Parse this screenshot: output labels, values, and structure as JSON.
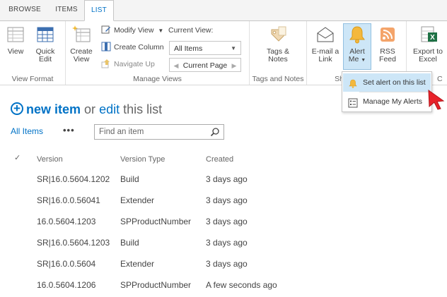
{
  "tabs": {
    "browse": "BROWSE",
    "items": "ITEMS",
    "list": "LIST"
  },
  "ribbon": {
    "view_format": {
      "label": "View Format",
      "view": "View",
      "quick_edit_1": "Quick",
      "quick_edit_2": "Edit"
    },
    "manage_views": {
      "label": "Manage Views",
      "create_view_1": "Create",
      "create_view_2": "View",
      "modify_view": "Modify View",
      "create_column": "Create Column",
      "navigate_up": "Navigate Up",
      "current_view_label": "Current View:",
      "current_view_value": "All Items",
      "current_page": "Current Page"
    },
    "tags_notes": {
      "label": "Tags and Notes",
      "btn_1": "Tags &",
      "btn_2": "Notes"
    },
    "share": {
      "label_partial": "Sh",
      "email_1": "E-mail a",
      "email_2": "Link",
      "alert_1": "Alert",
      "alert_2": "Me",
      "rss_1": "RSS",
      "rss_2": "Feed"
    },
    "connect": {
      "label_partial": "C",
      "export_1": "Export to",
      "export_2": "Excel"
    }
  },
  "alert_menu": {
    "set_alert": "Set alert on this list",
    "manage_alerts": "Manage My Alerts"
  },
  "title": {
    "new_item": "new item",
    "or": "or",
    "edit": "edit",
    "this_list": "this list"
  },
  "view": {
    "all_items": "All Items",
    "more": "•••",
    "search_placeholder": "Find an item"
  },
  "table": {
    "columns": [
      "Version",
      "Version Type",
      "Created"
    ],
    "rows": [
      [
        "SR|16.0.5604.1202",
        "Build",
        "3 days ago"
      ],
      [
        "SR|16.0.0.56041",
        "Extender",
        "3 days ago"
      ],
      [
        "16.0.5604.1203",
        "SPProductNumber",
        "3 days ago"
      ],
      [
        "SR|16.0.5604.1203",
        "Build",
        "3 days ago"
      ],
      [
        "SR|16.0.0.5604",
        "Extender",
        "3 days ago"
      ],
      [
        "16.0.5604.1206",
        "SPProductNumber",
        "A few seconds ago"
      ]
    ]
  },
  "colors": {
    "accent": "#0072c6",
    "highlight": "#cde6f7",
    "cursor": "#e8232b"
  }
}
